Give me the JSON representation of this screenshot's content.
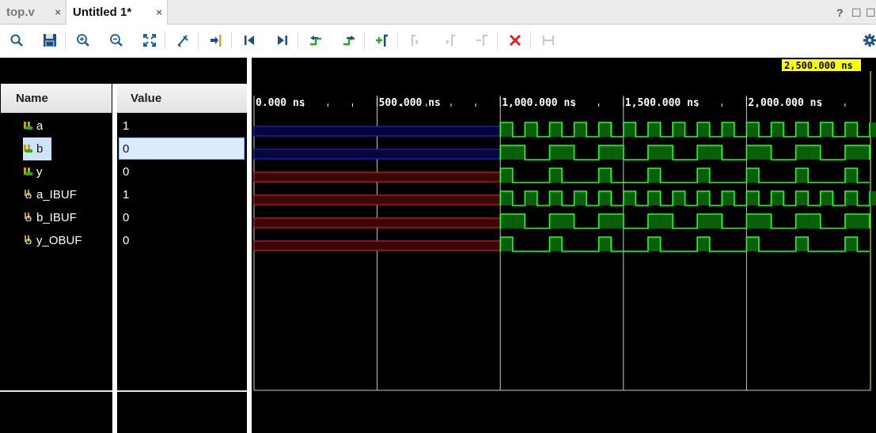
{
  "tabs": [
    {
      "label": "top.v",
      "close": "×",
      "active": false
    },
    {
      "label": "Untitled 1*",
      "close": "×",
      "active": true
    }
  ],
  "window_buttons": {
    "help": "?",
    "restore": "☐",
    "maximize": "☐"
  },
  "toolbar": {
    "buttons": [
      "search-icon",
      "save-icon",
      "zoom-in-icon",
      "zoom-out-icon",
      "zoom-fit-icon",
      "marker-icon",
      "go-to-cursor-icon",
      "go-to-start-icon",
      "go-to-end-icon",
      "previous-transition-icon",
      "next-transition-icon",
      "add-marker-icon",
      "previous-marker-icon",
      "next-marker-icon",
      "swap-cursors-icon",
      "delete-icon",
      "snap-icon",
      "settings-icon"
    ]
  },
  "columns": {
    "name": "Name",
    "value": "Value"
  },
  "signals": [
    {
      "name": "a",
      "value": "1",
      "kind": "input"
    },
    {
      "name": "b",
      "value": "0",
      "kind": "input",
      "selected": true
    },
    {
      "name": "y",
      "value": "0",
      "kind": "output"
    },
    {
      "name": "a_IBUF",
      "value": "1",
      "kind": "net"
    },
    {
      "name": "b_IBUF",
      "value": "0",
      "kind": "net"
    },
    {
      "name": "y_OBUF",
      "value": "0",
      "kind": "net"
    }
  ],
  "cursor_time": "2,500.000 ns",
  "time_axis": {
    "labels": [
      "0.000 ns",
      "500.000 ns",
      "1,000.000 ns",
      "1,500.000 ns",
      "2,000.000 ns"
    ],
    "label_ns": [
      0,
      500,
      1000,
      1500,
      2000
    ],
    "range_ns": [
      0,
      2500
    ]
  },
  "waveform": {
    "undefined_until_ns": 1000,
    "undefined_colors": {
      "a": "#2222dd",
      "b": "#2222dd",
      "y": "#cc2222",
      "a_IBUF": "#cc2222",
      "b_IBUF": "#cc2222",
      "y_OBUF": "#cc2222"
    },
    "a_period_ns": 100,
    "b_period_ns": 200,
    "logic_color": "#22ff22",
    "fill_color": "#0b5e0b"
  },
  "colors": {
    "accent_delete": "#e02020",
    "cursor_marker": "#ffff00",
    "grid": "#bbbbbb"
  }
}
